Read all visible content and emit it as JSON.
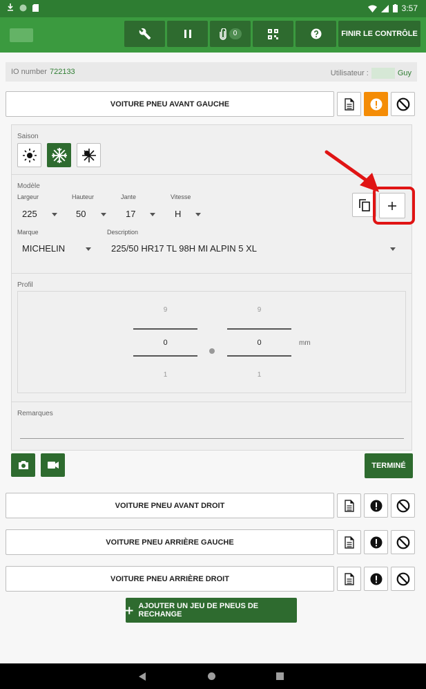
{
  "status": {
    "time": "3:57"
  },
  "toolbar": {
    "attachments_count": "0",
    "finish_label": "FINIR LE CONTRÔLE"
  },
  "info": {
    "io_label": "IO number",
    "io_value": "722133",
    "user_label": "Utilisateur :",
    "user_name": "Guy"
  },
  "tires": {
    "front_left": "VOITURE PNEU AVANT GAUCHE",
    "front_right": "VOITURE PNEU AVANT DROIT",
    "rear_left": "VOITURE PNEU ARRIÈRE GAUCHE",
    "rear_right": "VOITURE PNEU ARRIÈRE DROIT"
  },
  "form": {
    "season_label": "Saison",
    "model_label": "Modèle",
    "width_label": "Largeur",
    "width_value": "225",
    "height_label": "Hauteur",
    "height_value": "50",
    "rim_label": "Jante",
    "rim_value": "17",
    "speed_label": "Vitesse",
    "speed_value": "H",
    "brand_label": "Marque",
    "brand_value": "MICHELIN",
    "description_label": "Description",
    "description_value": "225/50 HR17 TL 98H  MI ALPIN 5 XL",
    "profile_label": "Profil",
    "profile_left": {
      "top": "9",
      "value": "0",
      "bottom": "1"
    },
    "profile_right": {
      "top": "9",
      "value": "0",
      "bottom": "1"
    },
    "unit": "mm",
    "remarks_label": "Remarques",
    "done_label": "TERMINÉ"
  },
  "add_spare_label": "AJOUTER UN JEU DE PNEUS DE RECHANGE",
  "colors": {
    "primary": "#3b9a3f",
    "dark_green": "#2e6b2f",
    "warning": "#f48c06",
    "annotation": "#e01414"
  }
}
